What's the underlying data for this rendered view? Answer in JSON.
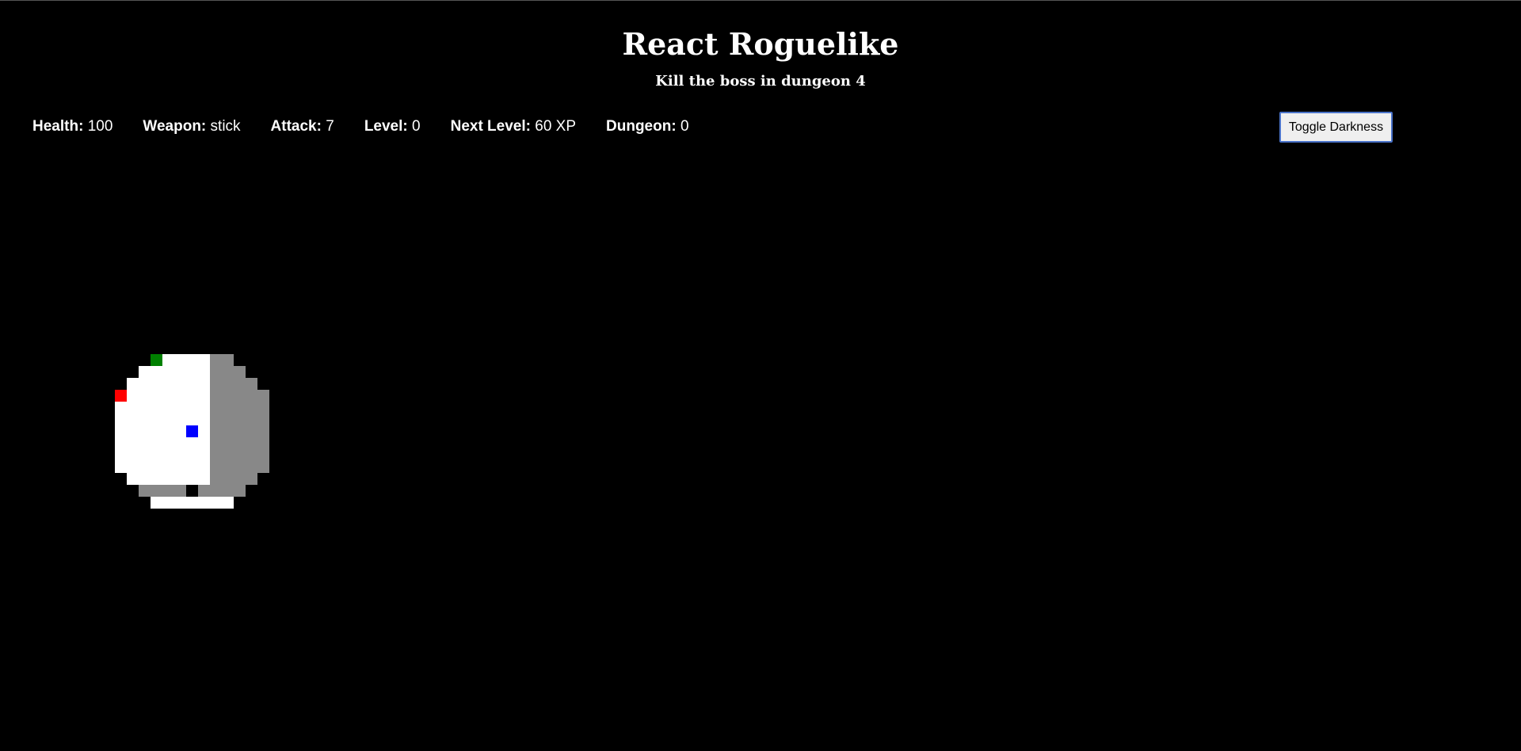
{
  "header": {
    "title": "React Roguelike",
    "subtitle": "Kill the boss in dungeon 4"
  },
  "stats": [
    {
      "label": "Health:",
      "value": "100"
    },
    {
      "label": "Weapon:",
      "value": "stick"
    },
    {
      "label": "Attack:",
      "value": "7"
    },
    {
      "label": "Level:",
      "value": "0"
    },
    {
      "label": "Next Level:",
      "value": "60 XP"
    },
    {
      "label": "Dungeon:",
      "value": "0"
    }
  ],
  "toolbar": {
    "toggle_label": "Toggle Darkness"
  },
  "colors": {
    "background": "#000000",
    "floor_lit": "#ffffff",
    "floor_dim": "#888888",
    "player": "#0000ff",
    "enemy": "#ff0000",
    "health_item": "#008000"
  },
  "entities": {
    "player": "player",
    "enemy": "enemy",
    "health": "health-pickup"
  }
}
